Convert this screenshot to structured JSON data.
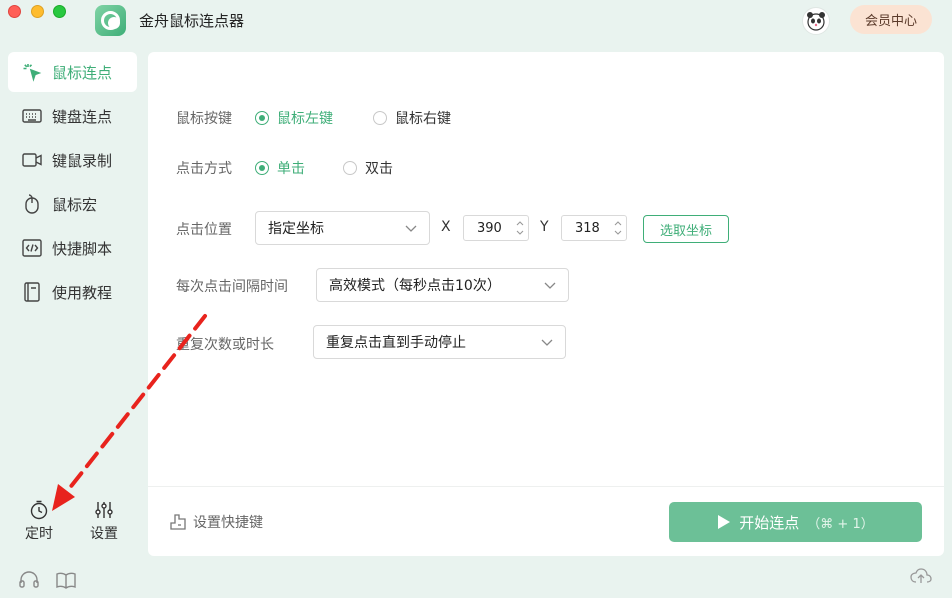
{
  "app": {
    "title": "金舟鼠标连点器",
    "member_label": "会员中心",
    "accent": "#3fae78"
  },
  "sidebar": {
    "items": [
      {
        "label": "鼠标连点",
        "icon": "click-cursor-icon",
        "active": true
      },
      {
        "label": "键盘连点",
        "icon": "keyboard-icon"
      },
      {
        "label": "键鼠录制",
        "icon": "video-record-icon"
      },
      {
        "label": "鼠标宏",
        "icon": "mouse-icon"
      },
      {
        "label": "快捷脚本",
        "icon": "code-icon"
      },
      {
        "label": "使用教程",
        "icon": "book-icon"
      }
    ],
    "tools": [
      {
        "label": "定时",
        "icon": "timer-icon"
      },
      {
        "label": "设置",
        "icon": "sliders-icon"
      }
    ],
    "footer": [
      "headset-icon",
      "open-book-icon"
    ]
  },
  "form": {
    "mouse_button": {
      "label": "鼠标按键",
      "options": [
        "鼠标左键",
        "鼠标右键"
      ],
      "selected": "鼠标左键"
    },
    "click_type": {
      "label": "点击方式",
      "options": [
        "单击",
        "双击"
      ],
      "selected": "单击"
    },
    "position": {
      "label": "点击位置",
      "mode": "指定坐标",
      "x_label": "X",
      "x": "390",
      "y_label": "Y",
      "y": "318",
      "pick_label": "选取坐标"
    },
    "interval": {
      "label": "每次点击间隔时间",
      "value": "高效模式（每秒点击10次）"
    },
    "repeat": {
      "label": "重复次数或时长",
      "value": "重复点击直到手动停止"
    }
  },
  "footer": {
    "hotkey_label": "设置快捷键",
    "start_label": "开始连点",
    "start_shortcut": "（⌘ + 1）"
  }
}
